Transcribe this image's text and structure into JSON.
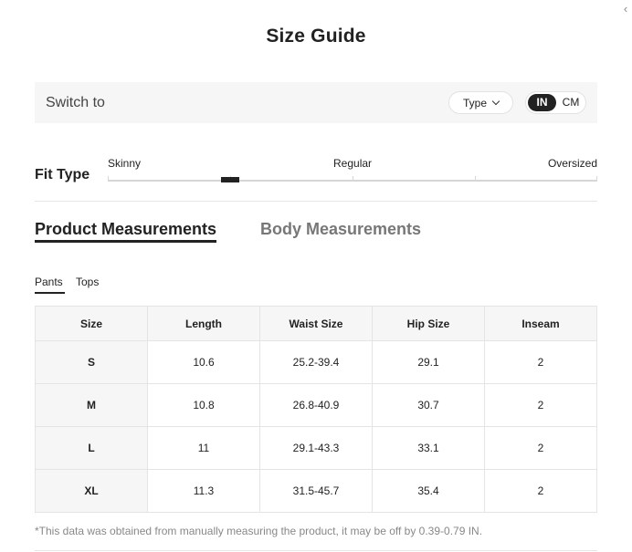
{
  "modal": {
    "title": "Size Guide",
    "close_icon": "close-icon"
  },
  "switch_bar": {
    "label": "Switch to",
    "type_dropdown": "Type",
    "units": [
      "IN",
      "CM"
    ],
    "selected_unit": "IN"
  },
  "fit_type": {
    "label": "Fit Type",
    "options": [
      "Skinny",
      "Regular",
      "Oversized"
    ],
    "marker_level": 0.25
  },
  "tabs": {
    "product": "Product Measurements",
    "body": "Body Measurements",
    "active": "Product Measurements"
  },
  "sub_tabs": {
    "pants": "Pants",
    "tops": "Tops",
    "active": "Pants"
  },
  "table": {
    "headers": [
      "Size",
      "Length",
      "Waist Size",
      "Hip Size",
      "Inseam"
    ],
    "rows": [
      [
        "S",
        "10.6",
        "25.2-39.4",
        "29.1",
        "2"
      ],
      [
        "M",
        "10.8",
        "26.8-40.9",
        "30.7",
        "2"
      ],
      [
        "L",
        "11",
        "29.1-43.3",
        "33.1",
        "2"
      ],
      [
        "XL",
        "11.3",
        "31.5-45.7",
        "35.4",
        "2"
      ]
    ]
  },
  "note": "*This data was obtained from manually measuring the product, it may be off by 0.39-0.79 IN."
}
